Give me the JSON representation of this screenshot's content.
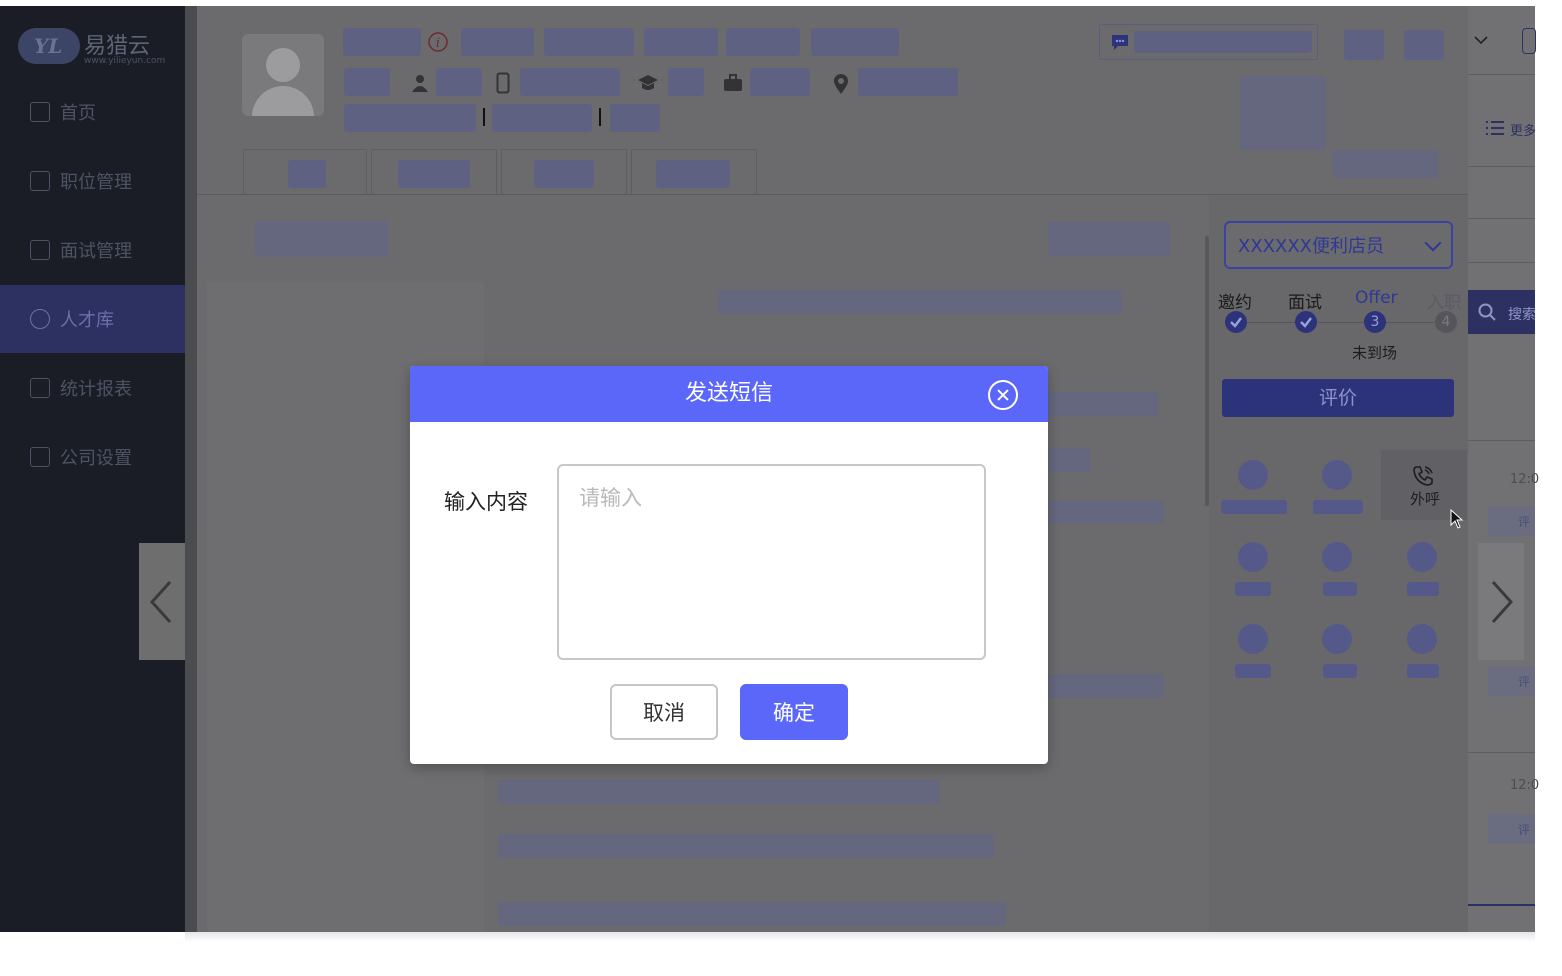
{
  "app": {
    "logo_text": "易猎云",
    "logo_mark": "YL",
    "logo_url": "www.yilieyun.com"
  },
  "sidebar": {
    "items": [
      {
        "label": "首页",
        "icon": "grid-icon"
      },
      {
        "label": "职位管理",
        "icon": "id-card-icon"
      },
      {
        "label": "面试管理",
        "icon": "briefcase-icon"
      },
      {
        "label": "人才库",
        "icon": "users-icon",
        "active": true
      },
      {
        "label": "统计报表",
        "icon": "chart-icon"
      },
      {
        "label": "公司设置",
        "icon": "settings-icon"
      }
    ]
  },
  "candidate_panel": {
    "position_select": "XXXXXX便利店员",
    "steps": [
      {
        "label": "邀约",
        "state": "done"
      },
      {
        "label": "面试",
        "state": "done"
      },
      {
        "label": "Offer",
        "state": "current",
        "number": "3"
      },
      {
        "label": "入职",
        "state": "pending",
        "number": "4"
      }
    ],
    "step_status": "未到场",
    "evaluate_button": "评价",
    "call_button": "外呼"
  },
  "right_strip": {
    "more_label": "更多",
    "search_label": "搜索",
    "times": [
      "12:0",
      "12:0"
    ],
    "eval_short": "评"
  },
  "modal": {
    "title": "发送短信",
    "field_label": "输入内容",
    "placeholder": "请输入",
    "value": "",
    "cancel_label": "取消",
    "confirm_label": "确定"
  },
  "colors": {
    "accent": "#5b67f8",
    "overlay": "#6f7071",
    "sidebar_bg": "#1a1d26"
  }
}
